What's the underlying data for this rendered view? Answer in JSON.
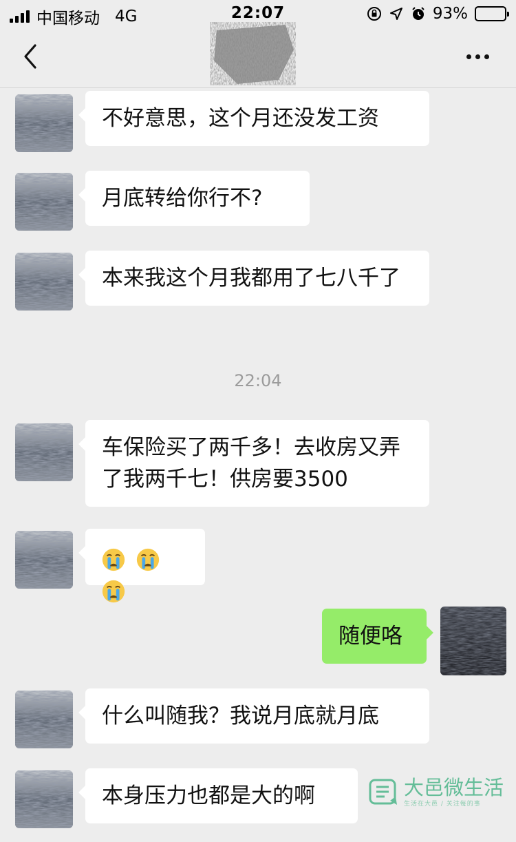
{
  "status_bar": {
    "carrier": "中国移动",
    "network": "4G",
    "time": "22:07",
    "battery_percent": "93%",
    "battery_level": 0.93
  },
  "nav": {
    "back_icon": "chevron-left-icon",
    "more_icon": "more-dots-icon"
  },
  "messages": [
    {
      "side": "in",
      "text": "不好意思，这个月还没发工资"
    },
    {
      "side": "in",
      "text": "月底转给你行不?"
    },
    {
      "side": "in",
      "text": "本来我这个月我都用了七八千了"
    },
    {
      "side": "in",
      "text": "车保险买了两千多！去收房又弄了我两千七！供房要3500"
    },
    {
      "side": "in",
      "text": "",
      "emoji": [
        "crying-face-emoji",
        "crying-face-emoji",
        "crying-face-emoji"
      ]
    },
    {
      "side": "out",
      "text": "随便咯"
    },
    {
      "side": "in",
      "text": "什么叫随我？我说月底就月底"
    },
    {
      "side": "in",
      "text": "本身压力也都是大的啊"
    }
  ],
  "timestamp": "22:04",
  "watermark": {
    "title": "大邑微生活",
    "subtitle": "生活在大邑 / 关注每的事"
  },
  "colors": {
    "background": "#ededed",
    "incoming_bubble": "#ffffff",
    "outgoing_bubble": "#95ec69",
    "timestamp_text": "#9b9b9b",
    "watermark": "#4db58a"
  }
}
